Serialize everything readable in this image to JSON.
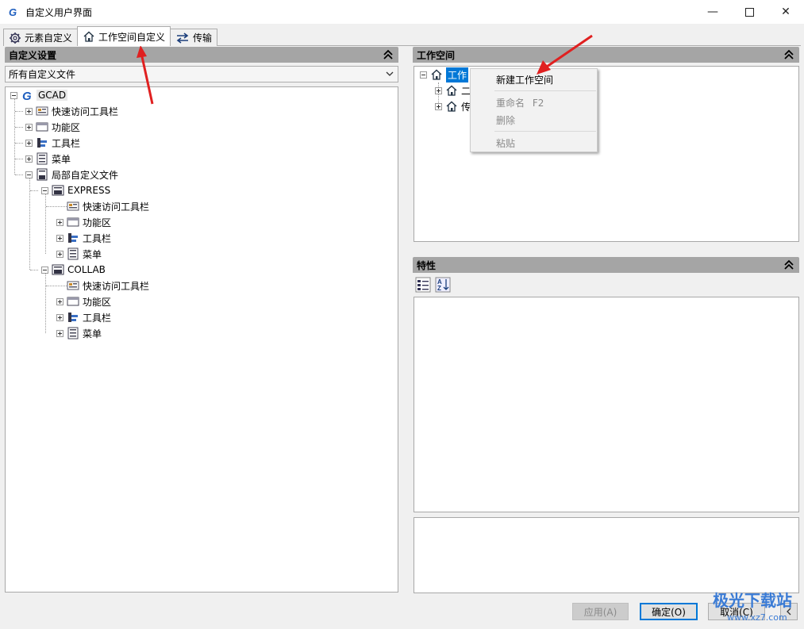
{
  "window": {
    "title": "自定义用户界面",
    "min": "—",
    "max": "☐",
    "close": "✕"
  },
  "tabs": [
    {
      "label": "元素自定义",
      "icon": "gear-icon"
    },
    {
      "label": "工作空间自定义",
      "icon": "home-icon",
      "active": true
    },
    {
      "label": "传输",
      "icon": "transfer-icon"
    }
  ],
  "left_panel": {
    "header": "自定义设置",
    "dropdown_value": "所有自定义文件",
    "tree": [
      {
        "label": "GCAD",
        "level": 0,
        "icon": "gcad-icon",
        "expander": "minus"
      },
      {
        "label": "快速访问工具栏",
        "level": 1,
        "icon": "quick-access-icon",
        "expander": "plus"
      },
      {
        "label": "功能区",
        "level": 1,
        "icon": "ribbon-icon",
        "expander": "plus"
      },
      {
        "label": "工具栏",
        "level": 1,
        "icon": "toolbar-icon",
        "expander": "plus"
      },
      {
        "label": "菜单",
        "level": 1,
        "icon": "menu-icon",
        "expander": "plus"
      },
      {
        "label": "局部自定义文件",
        "level": 1,
        "icon": "partial-cui-icon",
        "expander": "minus"
      },
      {
        "label": "EXPRESS",
        "level": 2,
        "icon": "cui-file-icon",
        "expander": "minus"
      },
      {
        "label": "快速访问工具栏",
        "level": 3,
        "icon": "quick-access-icon",
        "expander": "none"
      },
      {
        "label": "功能区",
        "level": 3,
        "icon": "ribbon-icon",
        "expander": "plus"
      },
      {
        "label": "工具栏",
        "level": 3,
        "icon": "toolbar-icon",
        "expander": "plus"
      },
      {
        "label": "菜单",
        "level": 3,
        "icon": "menu-icon",
        "expander": "plus"
      },
      {
        "label": "COLLAB",
        "level": 2,
        "icon": "cui-file-icon",
        "expander": "minus"
      },
      {
        "label": "快速访问工具栏",
        "level": 3,
        "icon": "quick-access-icon",
        "expander": "none"
      },
      {
        "label": "功能区",
        "level": 3,
        "icon": "ribbon-icon",
        "expander": "plus"
      },
      {
        "label": "工具栏",
        "level": 3,
        "icon": "toolbar-icon",
        "expander": "plus"
      },
      {
        "label": "菜单",
        "level": 3,
        "icon": "menu-icon",
        "expander": "plus"
      }
    ]
  },
  "workspace_panel": {
    "header": "工作空间",
    "root_label": "工作",
    "child1_label": "二",
    "child2_label": "传"
  },
  "context_menu": {
    "new_workspace": "新建工作空间",
    "rename": "重命名",
    "rename_shortcut": "F2",
    "delete": "删除",
    "paste": "粘贴"
  },
  "properties_panel": {
    "header": "特性"
  },
  "footer": {
    "apply": "应用(A)",
    "ok": "确定(O)",
    "cancel": "取消(C)"
  },
  "watermark": {
    "brand": "极光下载站",
    "site": "www.xz7.com"
  },
  "colors": {
    "accent": "#0078d7",
    "arrow": "#e02020",
    "header_gray": "#a5a5a5"
  }
}
